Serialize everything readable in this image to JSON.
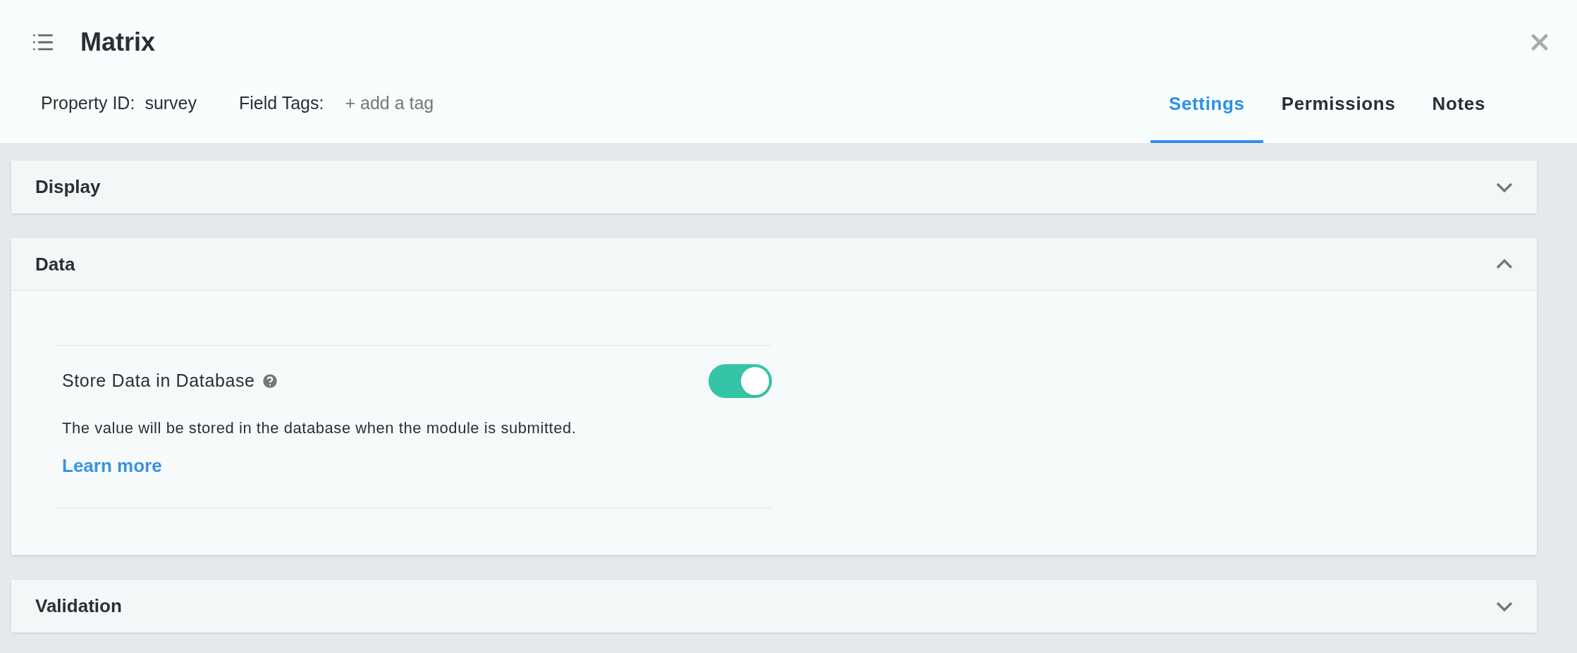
{
  "header": {
    "title": "Matrix",
    "property_label": "Property ID:",
    "property_value": "survey",
    "tags_label": "Field Tags:",
    "tags_action": "+ add a tag"
  },
  "tabs": [
    {
      "label": "Settings",
      "selected": true
    },
    {
      "label": "Permissions",
      "selected": false
    },
    {
      "label": "Notes",
      "selected": false
    }
  ],
  "sections": [
    {
      "title": "Display",
      "expanded": false
    },
    {
      "title": "Data",
      "expanded": true,
      "settings": [
        {
          "label": "Store Data in Database",
          "on": true,
          "description": "The value will be stored in the database when the module is submitted.",
          "link": "Learn more"
        }
      ]
    },
    {
      "title": "Validation",
      "expanded": false
    }
  ]
}
